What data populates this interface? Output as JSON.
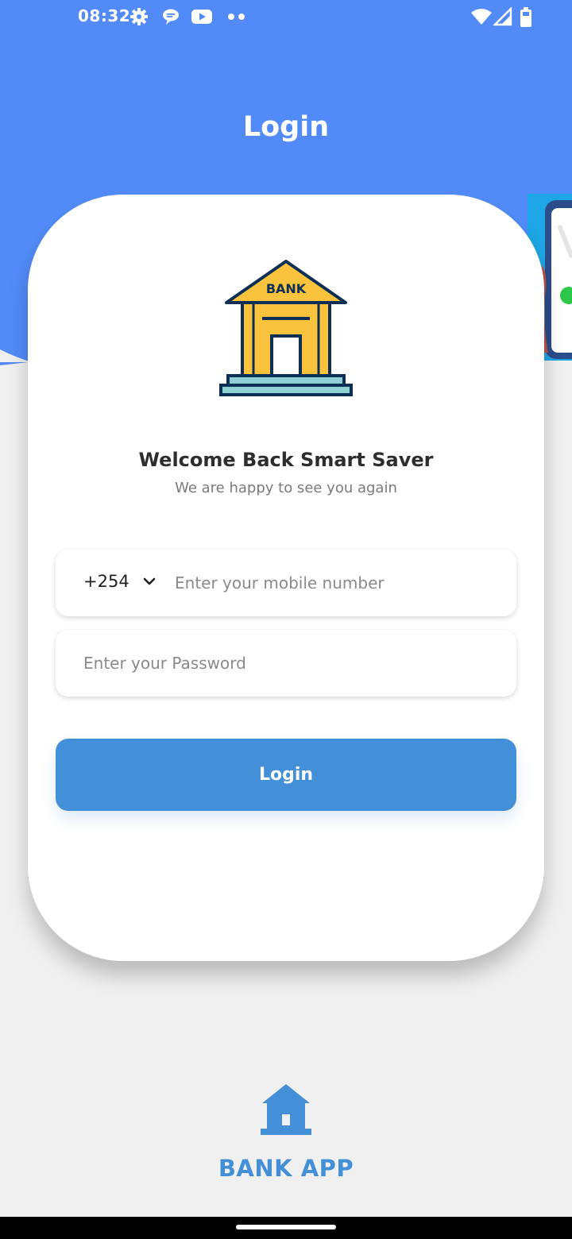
{
  "status_bar": {
    "time": "08:32",
    "left_icons": [
      "gear-icon",
      "chat-bubble-icon",
      "youtube-icon",
      "more-dots-icon"
    ],
    "right_icons": [
      "wifi-icon",
      "signal-icon",
      "battery-icon"
    ]
  },
  "header": {
    "title": "Login"
  },
  "welcome": {
    "title": "Welcome Back Smart Saver",
    "subtitle": "We are happy to see you again"
  },
  "bank_illustration": {
    "sign_text": "BANK"
  },
  "phone_field": {
    "country_code": "+254",
    "placeholder": "Enter your mobile number",
    "value": ""
  },
  "password_field": {
    "placeholder": "Enter your Password",
    "value": ""
  },
  "login_button": {
    "label": "Login"
  },
  "footer": {
    "app_name": "BANK APP"
  },
  "colors": {
    "header_blue": "#528bf8",
    "button_blue": "#4390d8",
    "background": "#f0f0f0",
    "bank_yellow": "#f9c33d",
    "bank_outline": "#0d2f55",
    "bank_teal": "#8fd0d3"
  }
}
